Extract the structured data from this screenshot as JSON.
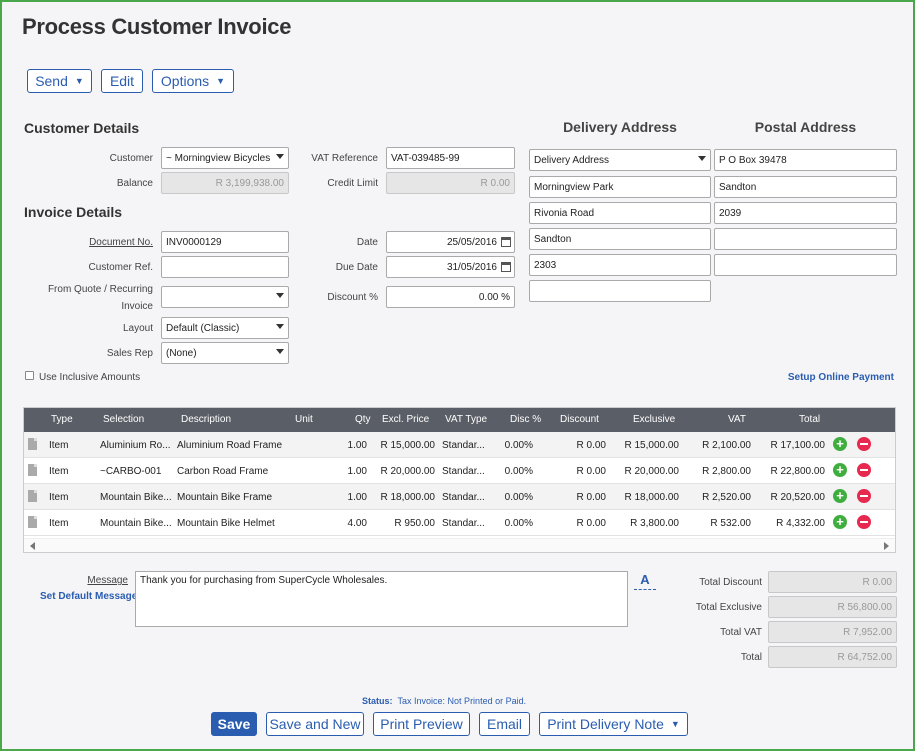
{
  "page": {
    "title": "Process Customer Invoice"
  },
  "toolbar": {
    "send": "Send",
    "edit": "Edit",
    "options": "Options"
  },
  "customer_details": {
    "heading": "Customer Details",
    "customer_label": "Customer",
    "customer_value": "~ Morningview Bicycles",
    "balance_label": "Balance",
    "balance_value": "R 3,199,938.00",
    "vat_ref_label": "VAT Reference",
    "vat_ref_value": "VAT-039485-99",
    "credit_limit_label": "Credit Limit",
    "credit_limit_value": "R 0.00"
  },
  "invoice_details": {
    "heading": "Invoice Details",
    "document_no_label": "Document No.",
    "document_no_value": "INV0000129",
    "customer_ref_label": "Customer Ref.",
    "customer_ref_value": "",
    "from_quote_label_1": "From Quote / Recurring",
    "from_quote_label_2": "Invoice",
    "from_quote_value": "",
    "layout_label": "Layout",
    "layout_value": "Default (Classic)",
    "sales_rep_label": "Sales Rep",
    "sales_rep_value": "(None)",
    "date_label": "Date",
    "date_value": "25/05/2016",
    "due_date_label": "Due Date",
    "due_date_value": "31/05/2016",
    "discount_label": "Discount %",
    "discount_value": "0.00 %",
    "inclusive_label": "Use Inclusive Amounts",
    "inclusive_checked": false
  },
  "delivery_address": {
    "heading": "Delivery Address",
    "lines": [
      "Delivery Address",
      "Morningview Park",
      "Rivonia Road",
      "Sandton",
      "2303",
      ""
    ]
  },
  "postal_address": {
    "heading": "Postal Address",
    "lines": [
      "P O Box 39478",
      "Sandton",
      "2039",
      "",
      ""
    ]
  },
  "setup_online_payment": "Setup Online Payment",
  "grid": {
    "headers": [
      "Type",
      "Selection",
      "Description",
      "Unit",
      "Qty",
      "Excl. Price",
      "VAT Type",
      "Disc %",
      "Discount",
      "Exclusive",
      "VAT",
      "Total"
    ],
    "rows": [
      [
        "Item",
        "Aluminium Ro...",
        "Aluminium Road Frame",
        "",
        "1.00",
        "R 15,000.00",
        "Standar...",
        "0.00%",
        "R 0.00",
        "R 15,000.00",
        "R 2,100.00",
        "R 17,100.00"
      ],
      [
        "Item",
        "~CARBO-001",
        "Carbon Road Frame",
        "",
        "1.00",
        "R 20,000.00",
        "Standar...",
        "0.00%",
        "R 0.00",
        "R 20,000.00",
        "R 2,800.00",
        "R 22,800.00"
      ],
      [
        "Item",
        "Mountain Bike...",
        "Mountain Bike Frame",
        "",
        "1.00",
        "R 18,000.00",
        "Standar...",
        "0.00%",
        "R 0.00",
        "R 18,000.00",
        "R 2,520.00",
        "R 20,520.00"
      ],
      [
        "Item",
        "Mountain Bike...",
        "Mountain Bike Helmet",
        "",
        "4.00",
        "R 950.00",
        "Standar...",
        "0.00%",
        "R 0.00",
        "R 3,800.00",
        "R 532.00",
        "R 4,332.00"
      ]
    ]
  },
  "message": {
    "label": "Message",
    "set_default": "Set Default Message",
    "value": "Thank you for purchasing from SuperCycle Wholesales.",
    "format_glyph": "A"
  },
  "totals": {
    "total_discount_label": "Total Discount",
    "total_discount_value": "R 0.00",
    "total_exclusive_label": "Total Exclusive",
    "total_exclusive_value": "R 56,800.00",
    "total_vat_label": "Total VAT",
    "total_vat_value": "R 7,952.00",
    "total_label": "Total",
    "total_value": "R 64,752.00"
  },
  "status": {
    "label": "Status:",
    "value": "Tax Invoice: Not Printed or Paid."
  },
  "footer": {
    "save": "Save",
    "save_new": "Save and New",
    "print_preview": "Print Preview",
    "email": "Email",
    "print_delivery": "Print Delivery Note"
  },
  "colors": {
    "accent": "#2a5db0",
    "frame": "#4aa84a",
    "grid_header": "#5a5e66",
    "add": "#3fae3f",
    "remove": "#e8294f"
  }
}
